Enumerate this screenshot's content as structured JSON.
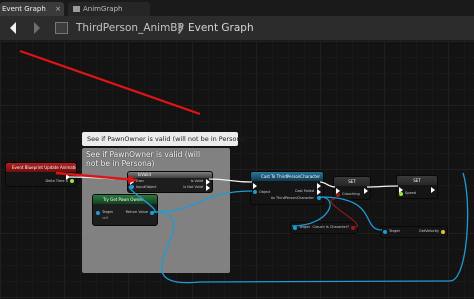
{
  "tabs": {
    "event_graph": "Event Graph",
    "event_graph_close": "×",
    "anim_graph": "AnimGraph"
  },
  "nav": {
    "back": "◆",
    "forward": "➜"
  },
  "breadcrumb": {
    "blueprint": "ThirdPerson_AnimBP",
    "separator": "❯",
    "graph": "Event Graph"
  },
  "comment": {
    "tooltip": "See if PawnOwner is valid (will not be in Persona)",
    "title": "See if PawnOwner is valid (will not be in Persona)"
  },
  "nodes": {
    "event": {
      "title": "Event Blueprint Update Animation",
      "delta_pin": "Delta Time X"
    },
    "is_valid": {
      "title": "IsValid",
      "exec_in": "Exec",
      "input": "InputObject",
      "is_valid": "Is Valid",
      "is_not_valid": "Is Not Valid"
    },
    "try_get": {
      "title": "Try Get Pawn Owner",
      "target": "Target",
      "target_value": "self",
      "return": "Return Value"
    },
    "cast": {
      "title": "Cast To ThirdPersonCharacter",
      "object": "Object",
      "cast_failed": "Cast Failed",
      "as": "As ThirdPersonCharacter"
    },
    "set_crouching": {
      "title": "SET",
      "pin": "Crouching"
    },
    "set_speed": {
      "title": "SET",
      "pin": "Speed"
    },
    "get_crouch": {
      "target": "Target",
      "label": "Crouch Is Character?"
    },
    "get_velocity": {
      "target": "Target",
      "label": "GetVelocity"
    }
  },
  "colors": {
    "exec_wire": "#f2f2f2",
    "object_wire": "#1d9bd7",
    "bool_wire": "#8a1818",
    "annotation_arrow": "#e01414",
    "event_header": "#b41e1e",
    "pure_header": "#2a7a3d",
    "cast_header": "#29789e"
  }
}
